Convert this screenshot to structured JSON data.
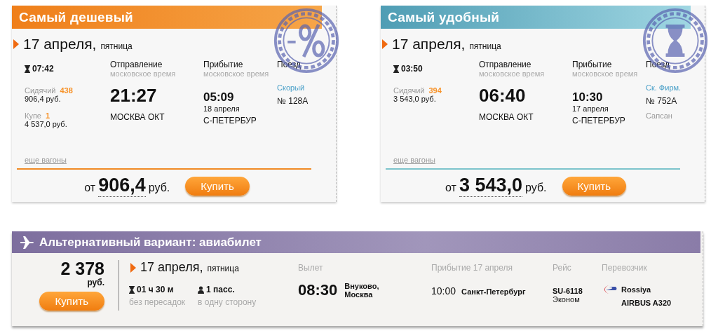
{
  "offers": [
    {
      "kind": "cheapest",
      "title": "Самый дешевый",
      "date": "17 апреля,",
      "weekday": "пятница",
      "duration": "07:42",
      "departure_label": "Отправление",
      "departure_note": "московское время",
      "arrival_label": "Прибытие",
      "arrival_note": "московское время",
      "train_label": "Поезд",
      "seats": [
        {
          "class": "Сидячий",
          "count": "438",
          "price": "906,4 руб."
        },
        {
          "class": "Купе",
          "count": "1",
          "price": "4 537,0 руб."
        }
      ],
      "dep_time": "21:27",
      "dep_station": "МОСКВА ОКТ",
      "arr_time": "05:09",
      "arr_date": "18 апреля",
      "arr_station": "С-ПЕТЕРБУР",
      "train_type": "Скорый",
      "train_number": "№ 128А",
      "more_link": "еще вагоны",
      "price_prefix": "от",
      "price": "906,4",
      "currency": "руб.",
      "buy": "Купить"
    },
    {
      "kind": "comfortable",
      "title": "Самый удобный",
      "date": "17 апреля,",
      "weekday": "пятница",
      "duration": "03:50",
      "departure_label": "Отправление",
      "departure_note": "московское время",
      "arrival_label": "Прибытие",
      "arrival_note": "московское время",
      "train_label": "Поезд",
      "seats": [
        {
          "class": "Сидячий",
          "count": "394",
          "price": "3 543,0 руб."
        }
      ],
      "dep_time": "06:40",
      "dep_station": "МОСКВА ОКТ",
      "arr_time": "10:30",
      "arr_date": "17 апреля",
      "arr_station": "С-ПЕТЕРБУР",
      "train_type": "Ск. Фирм.",
      "train_number": "№ 752А",
      "train_name": "Сапсан",
      "more_link": "еще вагоны",
      "price_prefix": "от",
      "price": "3 543,0",
      "currency": "руб.",
      "buy": "Купить"
    }
  ],
  "flight": {
    "title": "Альтернативный вариант: авиабилет",
    "price": "2 378",
    "currency": "руб.",
    "buy": "Купить",
    "date": "17 апреля,",
    "weekday": "пятница",
    "duration": "01 ч 30 м",
    "duration_note": "без пересадок",
    "passengers": "1 пасс.",
    "passengers_note": "в одну сторону",
    "departure_label": "Вылет",
    "dep_time": "08:30",
    "dep_airport": "Внуково,",
    "dep_city": "Москва",
    "arrival_label": "Прибытие 17 апреля",
    "arr_time": "10:00",
    "arr_city": "Санкт-Петербург",
    "flight_label": "Рейс",
    "flight_number": "SU-6118",
    "fare": "Эконом",
    "carrier_label": "Перевозчик",
    "carrier": "Rossiya",
    "aircraft": "AIRBUS A320"
  }
}
